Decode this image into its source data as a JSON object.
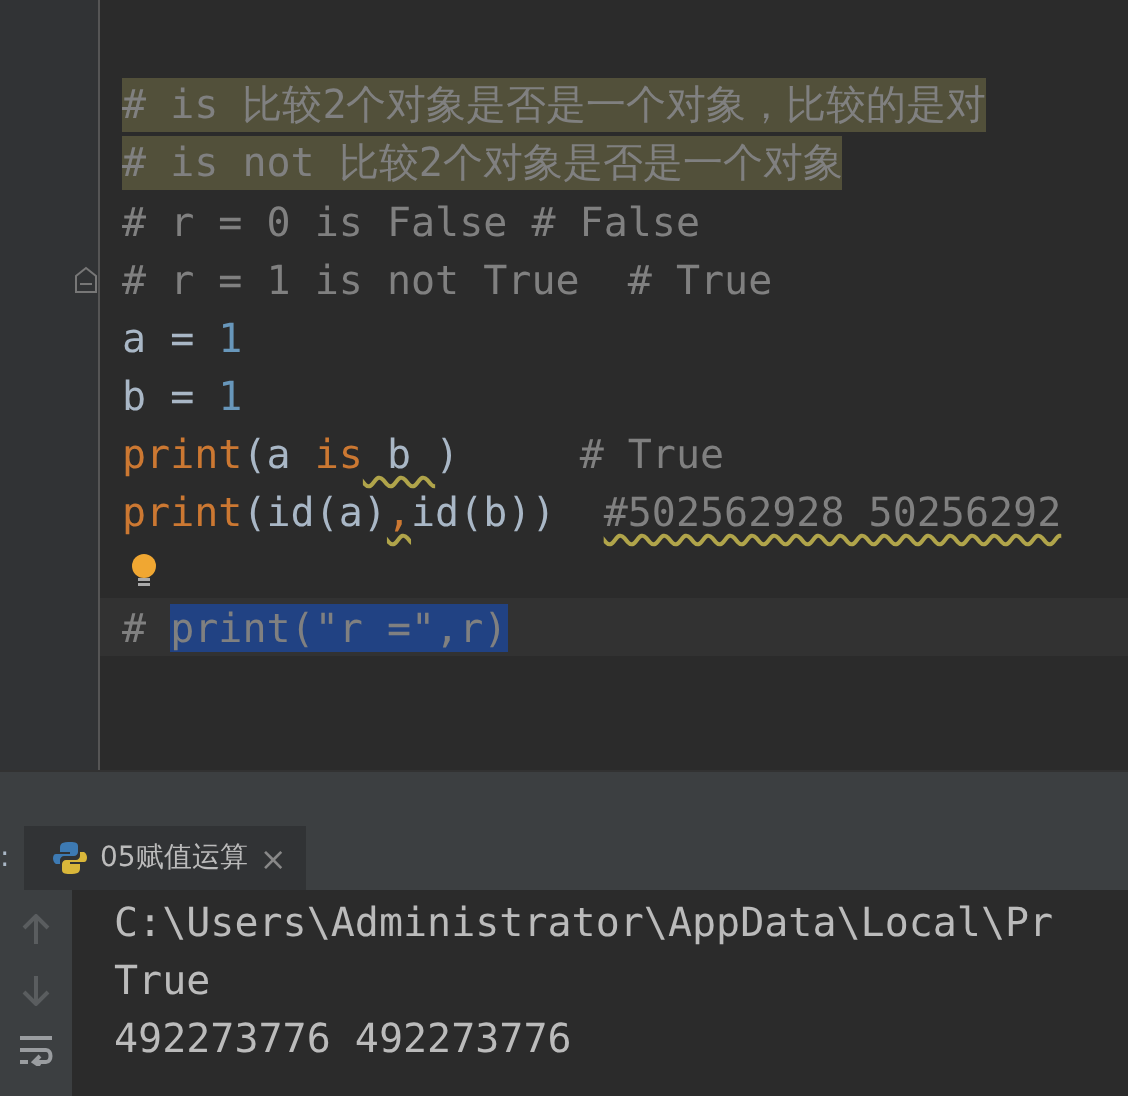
{
  "editor": {
    "lines": [
      {
        "kind": "normal",
        "highlighted": true,
        "fold": false,
        "bulb": false,
        "tokens": [
          {
            "text": "# is 比较2个对象是否是一个对象，比较的是对",
            "kind": "comment",
            "warning": false
          }
        ]
      },
      {
        "kind": "normal",
        "highlighted": true,
        "fold": false,
        "bulb": false,
        "tokens": [
          {
            "text": "# is not 比较2个对象是否是一个对象",
            "kind": "comment",
            "warning": false
          }
        ]
      },
      {
        "kind": "normal",
        "highlighted": false,
        "fold": false,
        "bulb": false,
        "tokens": [
          {
            "text": "# r = 0 is False # False",
            "kind": "comment",
            "warning": false
          }
        ]
      },
      {
        "kind": "normal",
        "highlighted": false,
        "fold": true,
        "bulb": false,
        "tokens": [
          {
            "text": "# r = 1 is not True  # True",
            "kind": "comment",
            "warning": false
          }
        ]
      },
      {
        "kind": "normal",
        "highlighted": false,
        "fold": false,
        "bulb": false,
        "tokens": [
          {
            "text": "a = ",
            "kind": "plain",
            "warning": false
          },
          {
            "text": "1",
            "kind": "number",
            "warning": false
          }
        ]
      },
      {
        "kind": "normal",
        "highlighted": false,
        "fold": false,
        "bulb": false,
        "tokens": [
          {
            "text": "b = ",
            "kind": "plain",
            "warning": false
          },
          {
            "text": "1",
            "kind": "number",
            "warning": false
          }
        ]
      },
      {
        "kind": "normal",
        "highlighted": false,
        "fold": false,
        "bulb": false,
        "tokens": [
          {
            "text": "print",
            "kind": "keyword",
            "warning": false
          },
          {
            "text": "(a ",
            "kind": "plain",
            "warning": false
          },
          {
            "text": "is",
            "kind": "keyword",
            "warning": false
          },
          {
            "text": " b ",
            "kind": "plain",
            "warning": true
          },
          {
            "text": ")     ",
            "kind": "plain",
            "warning": false
          },
          {
            "text": "# True",
            "kind": "comment",
            "warning": false
          }
        ]
      },
      {
        "kind": "normal",
        "highlighted": false,
        "fold": false,
        "bulb": false,
        "tokens": [
          {
            "text": "print",
            "kind": "keyword",
            "warning": false
          },
          {
            "text": "(id(a)",
            "kind": "plain",
            "warning": false
          },
          {
            "text": ",",
            "kind": "keyword",
            "warning": true
          },
          {
            "text": "id(b))  ",
            "kind": "plain",
            "warning": false
          },
          {
            "text": "#502562928 50256292",
            "kind": "comment",
            "warning": true
          }
        ]
      },
      {
        "kind": "normal",
        "highlighted": false,
        "fold": false,
        "bulb": true
      },
      {
        "kind": "current",
        "highlighted": false,
        "fold": false,
        "bulb": false,
        "tokens": [
          {
            "text": "# ",
            "kind": "comment",
            "warning": false
          },
          {
            "text": "print(\"r =\",r)",
            "kind": "selection",
            "warning": false
          }
        ]
      }
    ]
  },
  "run_panel": {
    "label": ":",
    "tab": {
      "title": "05赋值运算",
      "close": "×",
      "selected": true
    },
    "output": [
      "C:\\Users\\Administrator\\AppData\\Local\\Pr",
      "True",
      "492273776 492273776"
    ]
  }
}
